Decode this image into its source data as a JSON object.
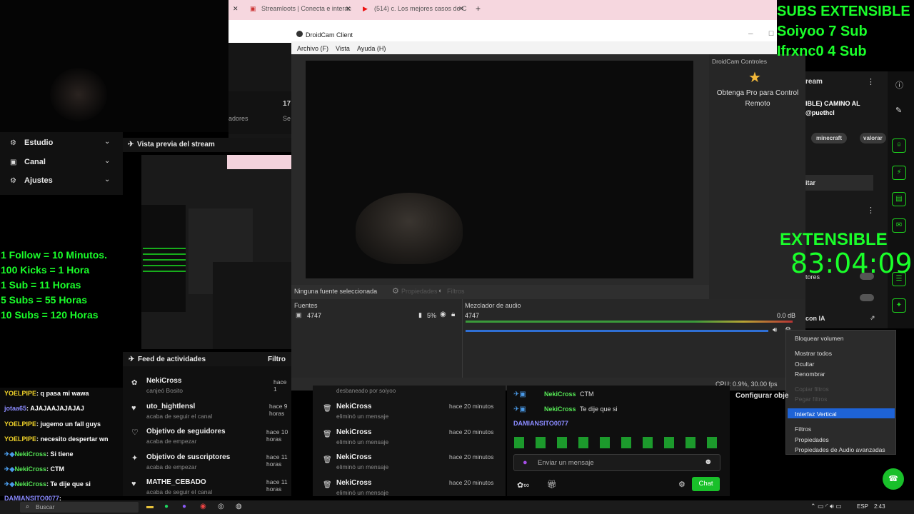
{
  "browser": {
    "tab1": "Streamloots | Conecta e interac",
    "tab2": "(514) c. Los mejores casos de C",
    "new_tab": "+"
  },
  "droidcam": {
    "title": "DroidCam Client",
    "menu": [
      "Archivo (F)",
      "Vista",
      "Ayuda (H)"
    ],
    "controls_title": "DroidCam Controles",
    "pro_text": "Obtenga Pro para Control Remoto"
  },
  "obs": {
    "no_source": "Ninguna fuente seleccionada",
    "properties": "Propiedades",
    "filters": "Filtros",
    "sources_label": "Fuentes",
    "source_name": "4747",
    "source_pct": "5%",
    "mixer_label": "Mezclador de audio",
    "mixer_source": "4747",
    "db": "0.0 dB",
    "status": "CPU: 0.9%, 30.00 fps",
    "context_menu": [
      "Bloquear volumen",
      "Mostrar todos",
      "Ocultar",
      "Renombrar",
      "Copiar filtros",
      "Pegar filtros",
      "Interfaz Vertical",
      "Filtros",
      "Propiedades",
      "Propiedades de Audio avanzadas"
    ]
  },
  "overlay": {
    "subs_title": "SUBS EXTENSIBLE",
    "sub1": "Soiyoo 7 Sub",
    "sub2": "Ifrxnc0 4 Sub",
    "ext_title": "EXTENSIBLE",
    "timer": "83:04:09",
    "rules": [
      "1 Follow = 10 Minutos.",
      "100 Kicks = 1 Hora",
      "1 Sub = 11 Horas",
      "5 Subs = 55 Horas",
      "10 Subs = 120 Horas"
    ]
  },
  "streamlabs": {
    "nav": [
      "Estudio",
      "Canal",
      "Ajustes"
    ],
    "preview_title": "Vista previa del stream",
    "feed_title": "Feed de actividades",
    "filter": "Filtro",
    "feed": [
      {
        "name": "NekiCross",
        "sub": "canjeó Bosito",
        "time": "hace 1"
      },
      {
        "name": "uto_hightlensl",
        "sub": "acaba de seguir el canal",
        "time": "hace 9 horas"
      },
      {
        "name": "Objetivo de seguidores",
        "sub": "acaba de empezar",
        "time": "hace 10 horas"
      },
      {
        "name": "Objetivo de suscriptores",
        "sub": "acaba de empezar",
        "time": "hace 11 horas"
      },
      {
        "name": "MATHE_CEBADO",
        "sub": "acaba de seguir el canal",
        "time": "hace 11 horas"
      }
    ],
    "mod_top": "desbaneado por soiyoo",
    "mod": [
      {
        "name": "NekiCross",
        "sub": "eliminó un mensaje",
        "time": "hace 20 minutos"
      },
      {
        "name": "NekiCross",
        "sub": "eliminó un mensaje",
        "time": "hace 20 minutos"
      },
      {
        "name": "NekiCross",
        "sub": "eliminó un mensaje",
        "time": "hace 20 minutos"
      },
      {
        "name": "NekiCross",
        "sub": "eliminó un mensaje",
        "time": "hace 20 minutos"
      }
    ],
    "chat": [
      {
        "user": "NekiCross",
        "msg": "CTM"
      },
      {
        "user": "NekiCross",
        "msg": "Te dije que si"
      },
      {
        "user": "DAMIANSITO0077",
        "msg": ""
      }
    ],
    "chat_placeholder": "Enviar un mensaje",
    "chat_button": "Chat",
    "config": "Configurar obje",
    "right": {
      "stream": "ream",
      "title": "IBLE) CAMINO AL",
      "user": "@puethcl",
      "tags": [
        "minecraft",
        "valorar"
      ],
      "edit": "itar",
      "ia": "con IA",
      "tores": "tores"
    },
    "partial": {
      "n": "17",
      "s": "Se",
      "adores": "adores"
    }
  },
  "chatlog": [
    {
      "user": "YOELPIPE",
      "msg": "q pasa mi wawa",
      "color": "#f2d42a"
    },
    {
      "user": "jotaa65",
      "msg": "AJAJAAJAJAJAJ",
      "color": "#8b8bff"
    },
    {
      "user": "YOELPIPE",
      "msg": "jugemo un fall guys",
      "color": "#f2d42a"
    },
    {
      "user": "YOELPIPE",
      "msg": "necesito despertar wn",
      "color": "#f2d42a"
    },
    {
      "user": "NekiCross",
      "msg": "Si tiene",
      "color": "#56e856"
    },
    {
      "user": "NekiCross",
      "msg": "CTM",
      "color": "#56e856"
    },
    {
      "user": "NekiCross",
      "msg": "Te dije que si",
      "color": "#56e856"
    },
    {
      "user": "DAMIANSITO0077",
      "msg": "",
      "color": "#8b8bff"
    }
  ],
  "taskbar": {
    "search": "Buscar",
    "lang": "ESP",
    "time": "2:43"
  }
}
